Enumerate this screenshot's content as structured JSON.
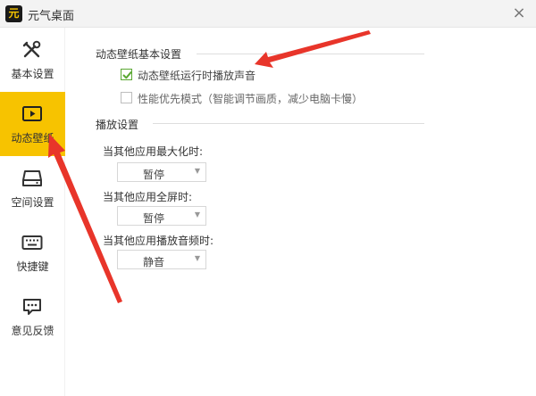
{
  "window": {
    "logo_text": "元",
    "title": "元气桌面",
    "close_glyph": "×"
  },
  "sidebar": {
    "items": [
      {
        "label": "基本设置",
        "icon": "tools-icon",
        "active": false
      },
      {
        "label": "动态壁纸",
        "icon": "play-screen-icon",
        "active": true
      },
      {
        "label": "空间设置",
        "icon": "disk-icon",
        "active": false
      },
      {
        "label": "快捷键",
        "icon": "keyboard-icon",
        "active": false
      },
      {
        "label": "意见反馈",
        "icon": "feedback-icon",
        "active": false
      }
    ]
  },
  "basic_section": {
    "title": "动态壁纸基本设置",
    "options": [
      {
        "label": "动态壁纸运行时播放声音",
        "checked": true
      },
      {
        "label": "性能优先模式（智能调节画质，减少电脑卡慢）",
        "checked": false
      }
    ]
  },
  "play_section": {
    "title": "播放设置",
    "fields": [
      {
        "label": "当其他应用最大化时:",
        "value": "暂停"
      },
      {
        "label": "当其他应用全屏时:",
        "value": "暂停"
      },
      {
        "label": "当其他应用播放音频时:",
        "value": "静音"
      }
    ]
  },
  "colors": {
    "accent": "#f7c300",
    "check_green": "#5aa832",
    "annotation_red": "#e8352a"
  }
}
